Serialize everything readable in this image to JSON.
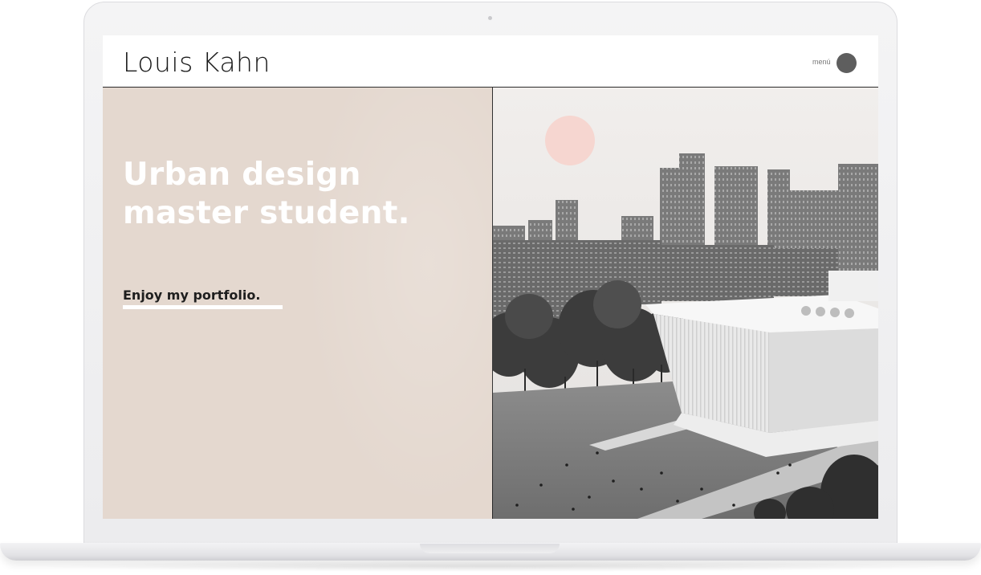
{
  "site": {
    "title": "Louis Kahn",
    "menu_label": "menú"
  },
  "hero": {
    "headline_line1": "Urban design",
    "headline_line2": "master student.",
    "cta_label": "Enjoy my portfolio."
  },
  "image": {
    "description_icon": "architecture-render-image"
  },
  "colors": {
    "panel": "#e4d8cf",
    "sun": "#f6d6d0",
    "menu_dot": "#5e5e5e",
    "text_dark": "#1a1a1a"
  }
}
